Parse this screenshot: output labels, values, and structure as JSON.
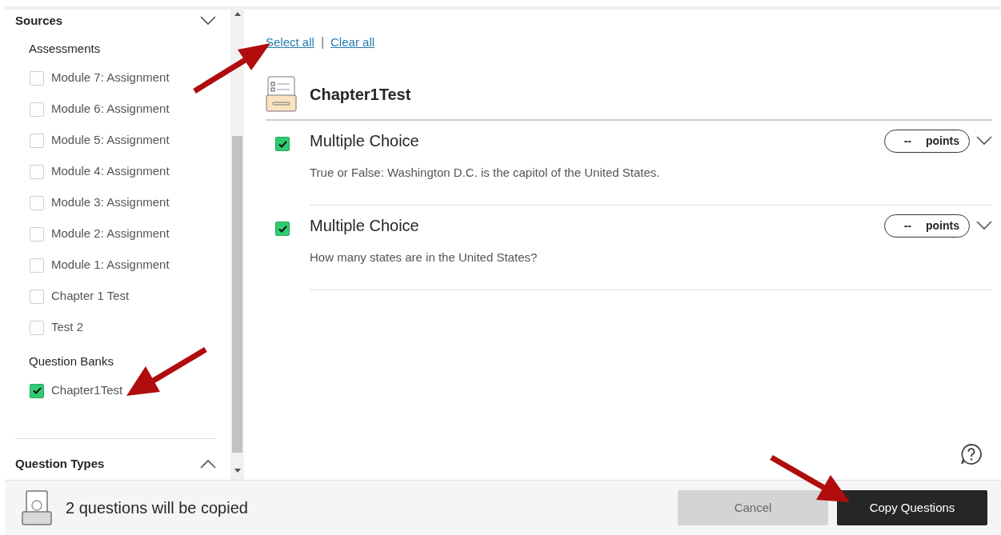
{
  "sidebar": {
    "sections": [
      {
        "title": "Sources",
        "expanded": true,
        "groups": [
          {
            "title": "Assessments",
            "items": [
              {
                "label": "Module 7: Assignment",
                "checked": false
              },
              {
                "label": "Module 6: Assignment",
                "checked": false
              },
              {
                "label": "Module 5: Assignment",
                "checked": false
              },
              {
                "label": "Module 4: Assignment",
                "checked": false
              },
              {
                "label": "Module 3: Assignment",
                "checked": false
              },
              {
                "label": "Module 2: Assignment",
                "checked": false
              },
              {
                "label": "Module 1: Assignment",
                "checked": false
              },
              {
                "label": "Chapter 1 Test",
                "checked": false
              },
              {
                "label": "Test 2",
                "checked": false
              }
            ]
          },
          {
            "title": "Question Banks",
            "items": [
              {
                "label": "Chapter1Test",
                "checked": true
              }
            ]
          }
        ]
      },
      {
        "title": "Question Types",
        "expanded": false
      }
    ]
  },
  "selection_links": [
    "Select all",
    "|",
    "Clear all"
  ],
  "bank": {
    "title": "Chapter1Test",
    "questions": [
      {
        "type": "Multiple Choice",
        "text": "True or False: Washington D.C. is the capitol of the United States.",
        "checked": true,
        "points": "--",
        "points_label": "points"
      },
      {
        "type": "Multiple Choice",
        "text": "How many states are in the United States?",
        "checked": true,
        "points": "--",
        "points_label": "points"
      }
    ]
  },
  "footer": {
    "summary": "2 questions will be copied",
    "buttons": [
      {
        "label": "Cancel",
        "kind": "secondary",
        "disabled": true
      },
      {
        "label": "Copy Questions",
        "kind": "primary",
        "disabled": false
      }
    ]
  }
}
